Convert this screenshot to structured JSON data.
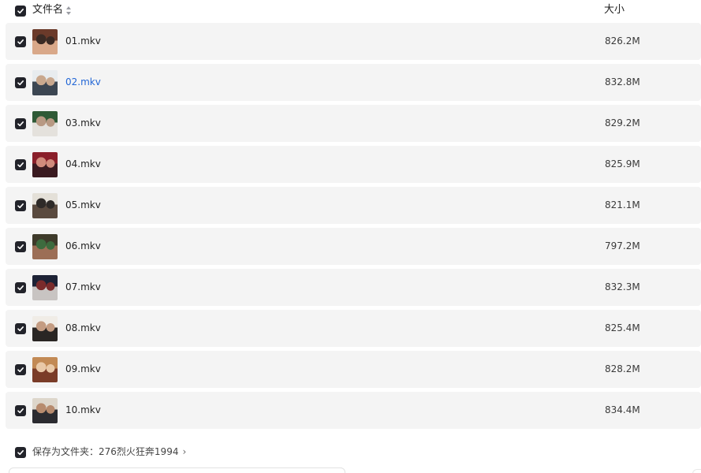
{
  "header": {
    "name_label": "文件名",
    "size_label": "大小"
  },
  "files": [
    {
      "name": "01.mkv",
      "size": "826.2M",
      "thumb": [
        "#6b3a2a",
        "#d9a889",
        "#3a2a24"
      ]
    },
    {
      "name": "02.mkv",
      "size": "832.8M",
      "thumb": [
        "#e8ecef",
        "#3c4652",
        "#c9a88e"
      ]
    },
    {
      "name": "03.mkv",
      "size": "829.2M",
      "thumb": [
        "#2f5a36",
        "#e4e1dc",
        "#b89983"
      ]
    },
    {
      "name": "04.mkv",
      "size": "825.9M",
      "thumb": [
        "#8a1f2a",
        "#3a1a20",
        "#d08b7c"
      ]
    },
    {
      "name": "05.mkv",
      "size": "821.1M",
      "thumb": [
        "#e4e0d8",
        "#5a4a3f",
        "#2e2a28"
      ]
    },
    {
      "name": "06.mkv",
      "size": "797.2M",
      "thumb": [
        "#3e3a2a",
        "#9c6e56",
        "#3d6b3e"
      ]
    },
    {
      "name": "07.mkv",
      "size": "832.3M",
      "thumb": [
        "#1d2235",
        "#c8c4c2",
        "#7a2b2b"
      ]
    },
    {
      "name": "08.mkv",
      "size": "825.4M",
      "thumb": [
        "#f0ece6",
        "#2a2624",
        "#c49c82"
      ]
    },
    {
      "name": "09.mkv",
      "size": "828.2M",
      "thumb": [
        "#c28a55",
        "#7a3c28",
        "#e9c9a8"
      ]
    },
    {
      "name": "10.mkv",
      "size": "834.4M",
      "thumb": [
        "#ddd6cb",
        "#2b2b30",
        "#b78b6e"
      ]
    }
  ],
  "active_index": 1,
  "footer": {
    "save_label": "保存为文件夹：",
    "folder_name": "276烈火狂奔1994"
  },
  "colors": {
    "checkbox": "#22232a",
    "row_bg": "#f4f4f4",
    "active_link": "#2266d6"
  },
  "icons": {
    "checkbox": "check-icon",
    "sort": "sort-icon",
    "chevron": "chevron-right-icon"
  }
}
